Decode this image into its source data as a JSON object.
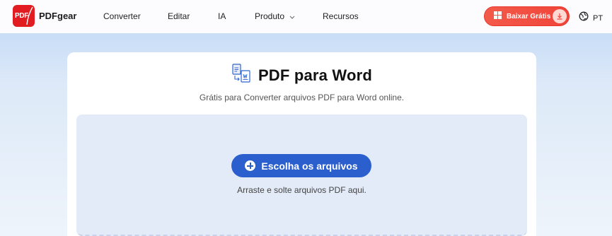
{
  "header": {
    "brand": "PDFgear",
    "logo_text": "PDF",
    "nav": [
      {
        "label": "Converter"
      },
      {
        "label": "Editar"
      },
      {
        "label": "IA"
      },
      {
        "label": "Produto"
      },
      {
        "label": "Recursos"
      }
    ],
    "download_label": "Baixar Grátis",
    "language": "PT"
  },
  "main": {
    "title": "PDF para Word",
    "subtitle": "Grátis para Converter arquivos PDF para Word online.",
    "choose_files_label": "Escolha os arquivos",
    "drop_hint": "Arraste e solte arquivos PDF aqui."
  },
  "colors": {
    "brand_red": "#e11d21",
    "download_button": "#f0443a",
    "primary_blue": "#2b5fcd",
    "dropzone_bg": "#e3ebf8"
  }
}
